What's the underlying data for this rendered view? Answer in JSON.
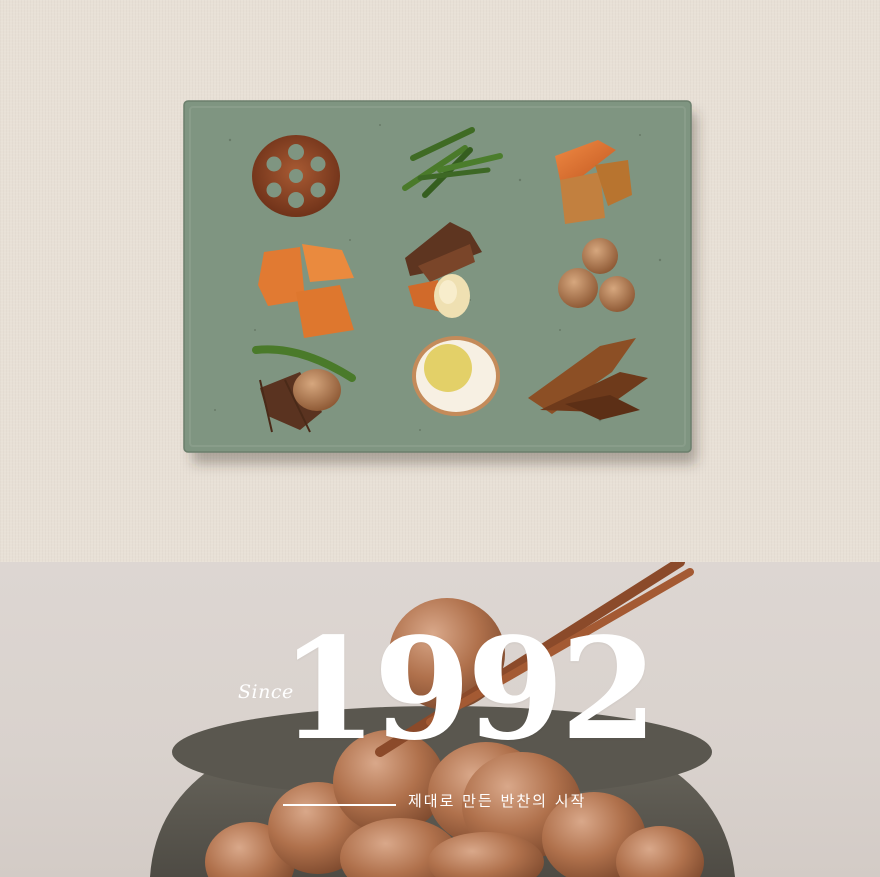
{
  "hero": {
    "since_label": "Since",
    "year": "1992",
    "tagline": "제대로 만든 반찬의 시작"
  },
  "colors": {
    "linen": "#e8e0d6",
    "plate": "#7f9581",
    "text": "#ffffff",
    "braise": "#9b6a44"
  },
  "images": {
    "plate": "green-plate-banchan-photo",
    "eggs": "braised-quail-eggs-bowl-photo"
  }
}
